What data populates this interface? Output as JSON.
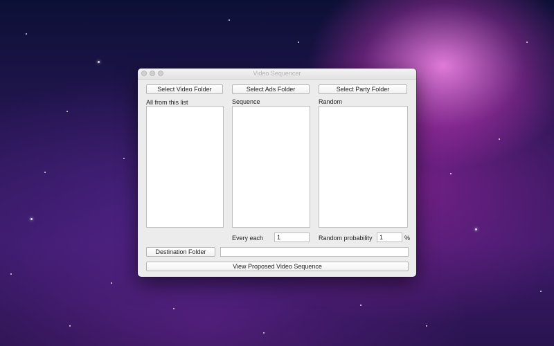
{
  "window": {
    "title": "Video Sequencer"
  },
  "buttons": {
    "select_video_folder": "Select Video Folder",
    "select_ads_folder": "Select Ads Folder",
    "select_party_folder": "Select Party Folder",
    "destination_folder": "Destination Folder",
    "view_sequence": "View Proposed Video Sequence"
  },
  "columns": {
    "video": {
      "label": "All from this list",
      "items": []
    },
    "ads": {
      "label": "Sequence",
      "items": []
    },
    "party": {
      "label": "Random",
      "items": []
    }
  },
  "controls": {
    "every_each_label": "Every each",
    "every_each_value": "1",
    "random_probability_label": "Random probability",
    "random_probability_value": "1",
    "percent_symbol": "%",
    "destination_path_value": ""
  }
}
